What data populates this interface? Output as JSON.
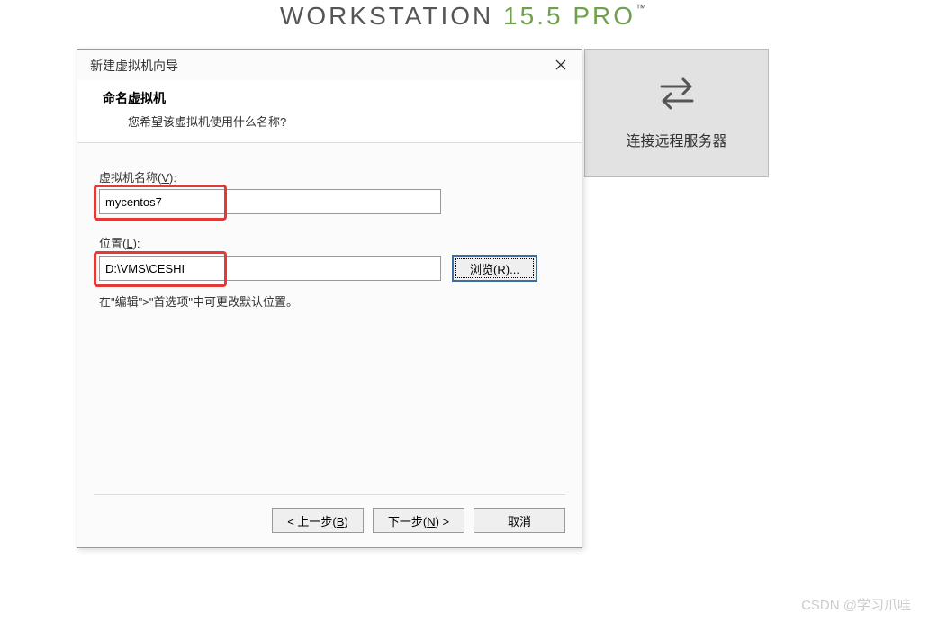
{
  "brand": {
    "name": "WORKSTATION",
    "version": "15.5",
    "edition": "PRO",
    "tm": "™"
  },
  "dialog": {
    "title": "新建虚拟机向导",
    "header_title": "命名虚拟机",
    "header_sub": "您希望该虚拟机使用什么名称?",
    "vm_name_label_pre": "虚拟机名称(",
    "vm_name_label_key": "V",
    "vm_name_label_post": "):",
    "vm_name_value": "mycentos7",
    "location_label_pre": "位置(",
    "location_label_key": "L",
    "location_label_post": "):",
    "location_value": "D:\\VMS\\CESHI",
    "browse_pre": "浏览(",
    "browse_key": "R",
    "browse_post": ")...",
    "hint": "在\"编辑\">\"首选项\"中可更改默认位置。",
    "back_pre": "< 上一步(",
    "back_key": "B",
    "back_post": ")",
    "next_pre": "下一步(",
    "next_key": "N",
    "next_post": ") >",
    "cancel": "取消"
  },
  "side": {
    "label": "连接远程服务器"
  },
  "watermark": "CSDN @学习爪哇"
}
